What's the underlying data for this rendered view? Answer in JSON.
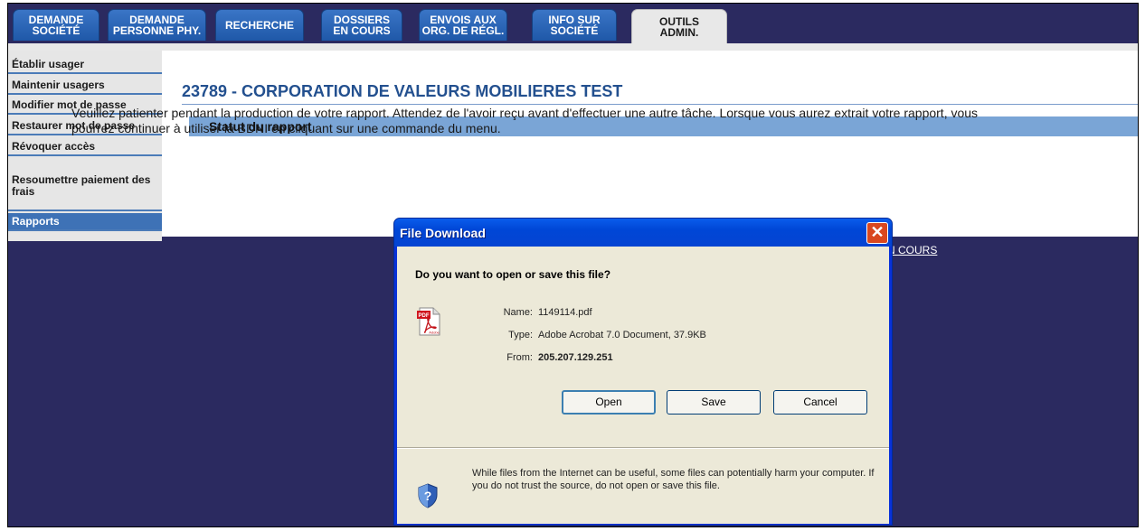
{
  "tabs": [
    {
      "label": "DEMANDE\nSOCIÉTÉ"
    },
    {
      "label": "DEMANDE\nPERSONNE PHY."
    },
    {
      "label": "RECHERCHE"
    },
    {
      "label": "DOSSIERS\nEN COURS"
    },
    {
      "label": "ENVOIS AUX\nORG. DE RÉGL."
    },
    {
      "label": "INFO SUR\nSOCIÉTÉ"
    },
    {
      "label": "OUTILS\nADMIN."
    }
  ],
  "sidebar": {
    "items": [
      {
        "label": "Établir usager"
      },
      {
        "label": "Maintenir usagers"
      },
      {
        "label": "Modifier mot de passe"
      },
      {
        "label": "Restaurer mot de passe"
      },
      {
        "label": "Révoquer accès"
      },
      {
        "label": "Resoumettre paiement des frais"
      },
      {
        "label": "Rapports"
      }
    ]
  },
  "main": {
    "title": "23789 - CORPORATION DE VALEURS MOBILIERES TEST",
    "section_title": "Statut du rapport",
    "status_text": "Veuillez patienter pendant la production de votre rapport. Attendez de l'avoir reçu avant d'effectuer une autre tâche. Lorsque vous aurez extrait votre rapport, vous pourrez continuer à utiliser la BDNI en cliquant sur une commande du menu.",
    "link_text": "N COURS"
  },
  "dialog": {
    "title": "File Download",
    "question": "Do you want to open or save this file?",
    "name_label": "Name:",
    "name_value": "1149114.pdf",
    "type_label": "Type:",
    "type_value": "Adobe Acrobat 7.0 Document, 37.9KB",
    "from_label": "From:",
    "from_value": "205.207.129.251",
    "open_label": "Open",
    "save_label": "Save",
    "cancel_label": "Cancel",
    "warning": "While files from the Internet can be useful, some files can potentially harm your computer. If you do not trust the source, do not open or save this file."
  },
  "icons": {
    "file": "pdf-file-icon",
    "warning": "shield-question-icon",
    "close": "close-icon"
  },
  "colors": {
    "nav_tab": "#1f58a8",
    "background": "#2b2a60",
    "title_text": "#23508f",
    "status_bar": "#7aa5d6",
    "dialog_title": "#0046d6",
    "close_button": "#d9481f"
  }
}
